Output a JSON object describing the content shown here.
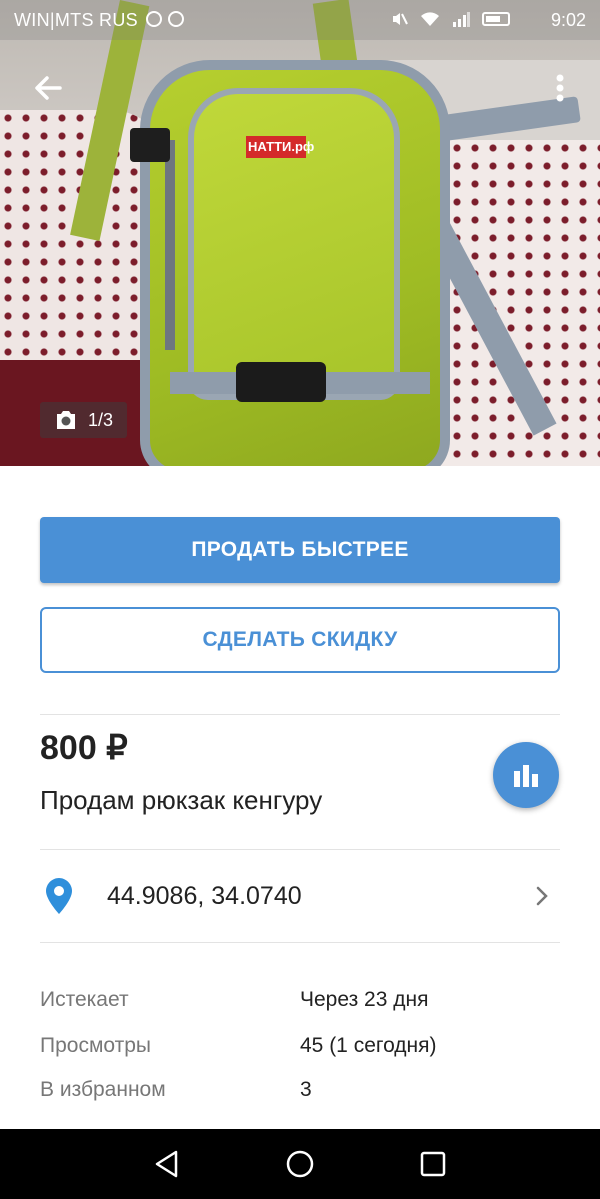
{
  "status_bar": {
    "carrier": "WIN|MTS RUS",
    "time": "9:02"
  },
  "gallery": {
    "counter": "1/3",
    "logo_text": "НАТТИ.рф"
  },
  "actions": {
    "sell_faster_label": "ПРОДАТЬ БЫСТРЕЕ",
    "discount_label": "СДЕЛАТЬ СКИДКУ"
  },
  "listing": {
    "price": "800 ₽",
    "title": "Продам рюкзак кенгуру"
  },
  "location": {
    "coords": "44.9086, 34.0740"
  },
  "info": [
    {
      "label": "Истекает",
      "value": "Через 23 дня"
    },
    {
      "label": "Просмотры",
      "value": "45 (1 сегодня)"
    },
    {
      "label": "В избранном",
      "value": "3"
    }
  ],
  "colors": {
    "accent": "#4a90d6",
    "pin": "#2f8fdb",
    "nav_bar": "#000000"
  },
  "icons": [
    "back-arrow-icon",
    "more-vert-icon",
    "camera-icon",
    "bar-chart-icon",
    "location-pin-icon",
    "chevron-right-icon",
    "nav-back-icon",
    "nav-home-icon",
    "nav-recents-icon"
  ]
}
